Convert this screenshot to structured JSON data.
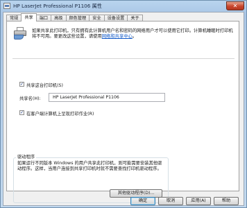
{
  "window": {
    "title": "HP LaserJet Professional P1106 属性",
    "close_glyph": "✕"
  },
  "tabs": [
    {
      "label": "常规"
    },
    {
      "label": "共享"
    },
    {
      "label": "端口"
    },
    {
      "label": "高级"
    },
    {
      "label": "颜色管理"
    },
    {
      "label": "安全"
    },
    {
      "label": "设备设置"
    },
    {
      "label": "关于"
    }
  ],
  "active_tab": "共享",
  "share": {
    "intro_text": "如果共享此打印机，只有拥有此计算机用户名和密码的网络用户才可以使用它打印。计算机睡眠时打印机将不可用。要更改这些设置，请使用",
    "intro_link": "网络和共享中心",
    "intro_end": "。",
    "share_checkbox_label": "共享这台打印机(S)",
    "share_checked": true,
    "share_name_label": "共享名(H):",
    "share_name_value": "HP LaserJet Professional P1106",
    "render_checkbox_label": "在客户端计算机上呈现打印作业(R)",
    "render_checked": true,
    "check_glyph": "✓"
  },
  "drivers": {
    "group_title": "驱动程序",
    "text": "如果运行不同版本 Windows 的用户共享此打印机，则可能需要安装其他驱动程序。这样，当用户连接到共享打印机时就不需要查找打印机驱动程序。",
    "button_label": "其他驱动程序(D)..."
  },
  "footer": {
    "ok": "确定",
    "cancel": "取消",
    "apply": "应用(A)",
    "help": "帮助"
  }
}
